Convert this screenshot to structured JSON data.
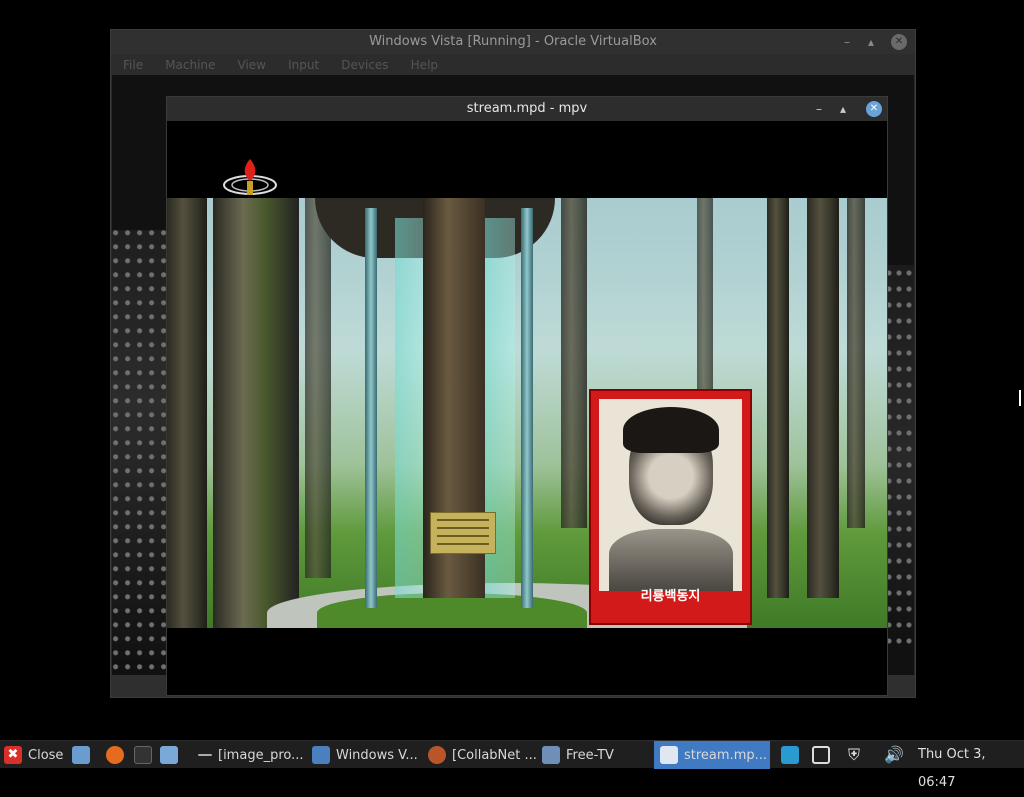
{
  "vbox": {
    "title": "Windows Vista [Running] - Oracle VirtualBox",
    "menu": [
      "File",
      "Machine",
      "View",
      "Input",
      "Devices",
      "Help"
    ]
  },
  "mpv": {
    "title": "stream.mpd - mpv",
    "portrait_caption": "리룡백동지"
  },
  "taskbar": {
    "close_label": "Close",
    "tasks": [
      {
        "label": "[image_pro..."
      },
      {
        "label": "Windows V..."
      },
      {
        "label": "[CollabNet ..."
      },
      {
        "label": "Free-TV"
      },
      {
        "label": "stream.mp..."
      }
    ],
    "clock": "Thu Oct  3, 06:47"
  },
  "colors": {
    "taskbar_bg": "#1f1f1f",
    "active_task": "#3f7ac2",
    "portrait_red": "#d21a1a",
    "mpv_close": "#6aa3d8"
  }
}
